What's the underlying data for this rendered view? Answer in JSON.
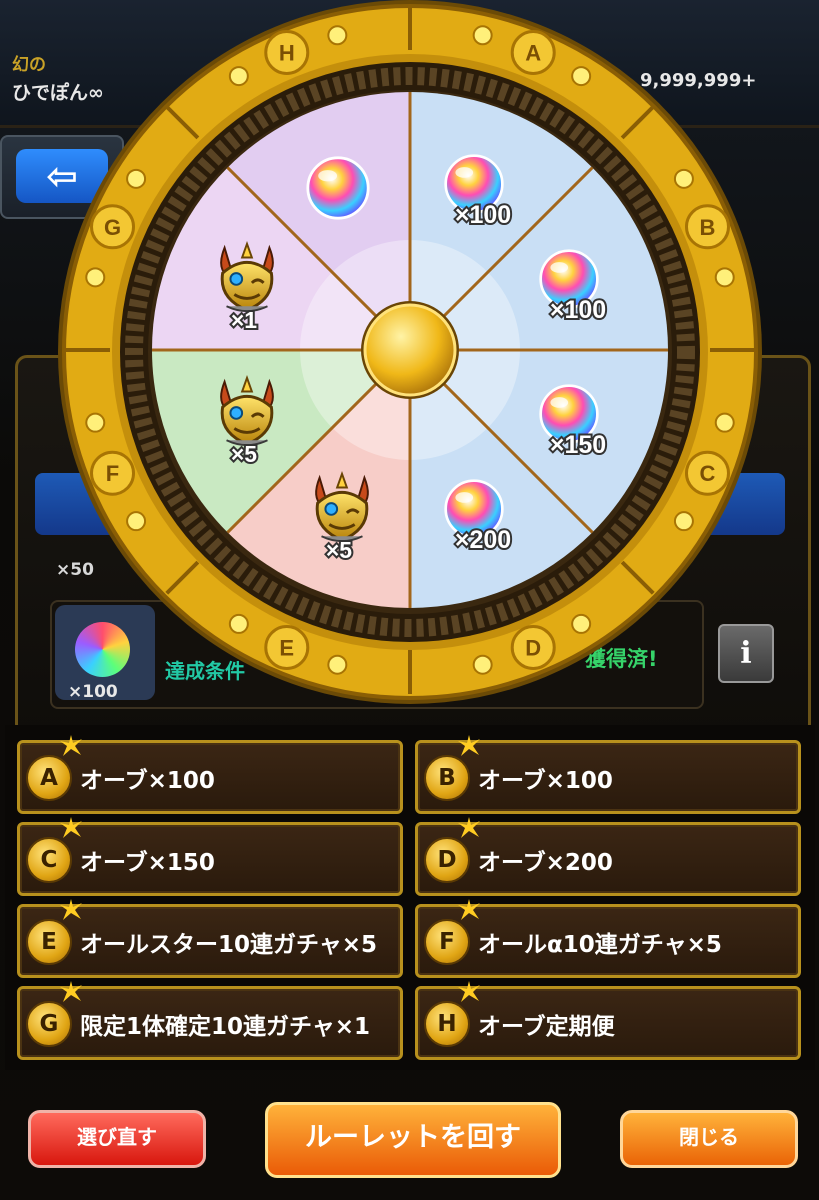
{
  "header": {
    "player_title": "幻の",
    "player_name": "ひでぽん∞",
    "points": "9,999,999+"
  },
  "background": {
    "back_arrow": "⇦",
    "thumb_count": "×100",
    "partial_count": "×50",
    "condition_text": "達成条件",
    "obtained_text": "獲得済!",
    "info_label": "i"
  },
  "wheel": {
    "letters": [
      "A",
      "B",
      "C",
      "D",
      "E",
      "F",
      "G",
      "H"
    ],
    "segments": {
      "a_count": "×100",
      "b_count": "×100",
      "c_count": "×150",
      "d_count": "×200",
      "e_count": "×5",
      "f_count": "×5",
      "g_count": "×1"
    },
    "colors": {
      "orb_side": "#c9dff5",
      "h_seg": "#e2cdf1",
      "g_seg": "#ecd6f3",
      "f_seg": "#c9e9c2",
      "e_seg": "#f7cdc8",
      "frame": "#e1ab14",
      "spoke": "#a2661b"
    }
  },
  "prizes": [
    {
      "letter": "A",
      "label": "オーブ×100"
    },
    {
      "letter": "B",
      "label": "オーブ×100"
    },
    {
      "letter": "C",
      "label": "オーブ×150"
    },
    {
      "letter": "D",
      "label": "オーブ×200"
    },
    {
      "letter": "E",
      "label": "オールスター10連ガチャ×5"
    },
    {
      "letter": "F",
      "label": "オールα10連ガチャ×5"
    },
    {
      "letter": "G",
      "label": "限定1体確定10連ガチャ×1"
    },
    {
      "letter": "H",
      "label": "オーブ定期便"
    }
  ],
  "buttons": {
    "redo": "選び直す",
    "spin": "ルーレットを回す",
    "close": "閉じる"
  }
}
